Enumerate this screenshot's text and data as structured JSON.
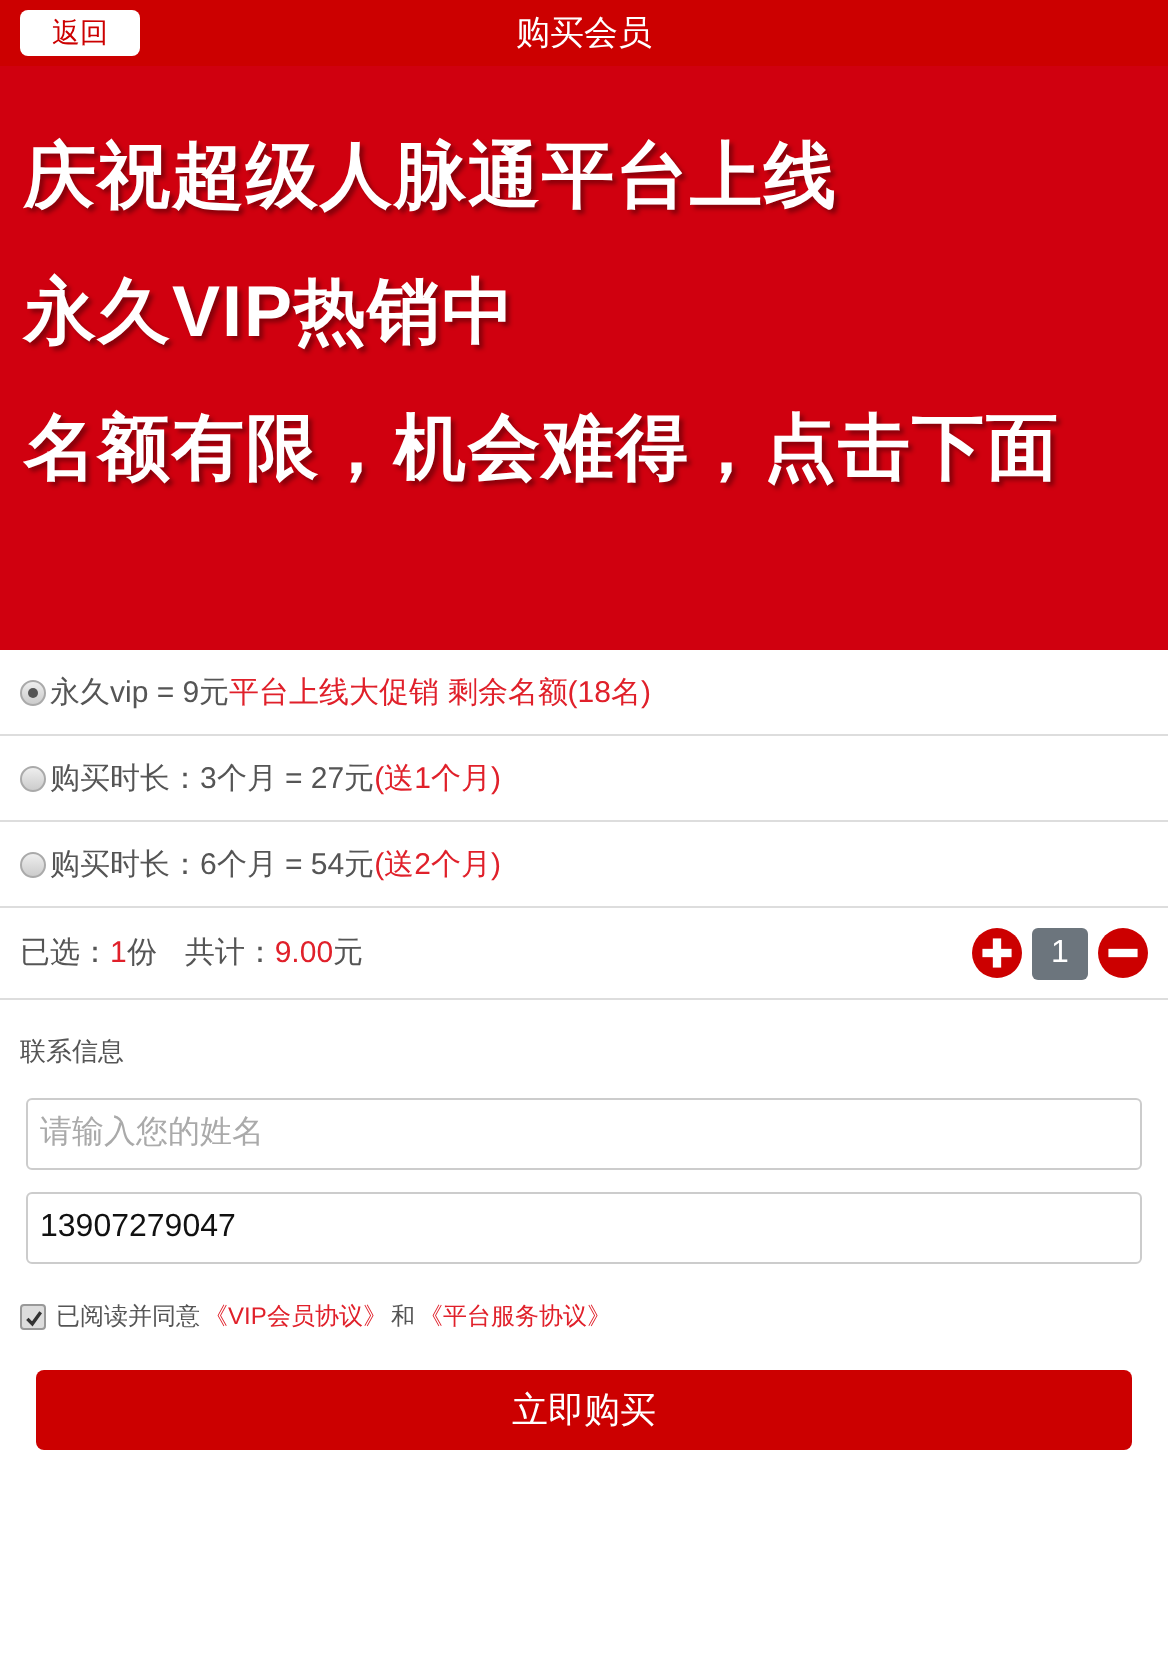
{
  "header": {
    "back_button": "返回",
    "title": "购买会员"
  },
  "banner": {
    "lines": [
      "庆祝超级人脉通平台上线",
      "永久VIP热销中",
      "名额有限，机会难得，点击下面"
    ]
  },
  "plans": [
    {
      "label": "永久vip = 9元 ",
      "promo": "平台上线大促销 剩余名额(18名)",
      "selected": true
    },
    {
      "label": "购买时长：3个月 = 27元",
      "promo": "(送1个月)",
      "selected": false
    },
    {
      "label": "购买时长：6个月 = 54元",
      "promo": "(送2个月)",
      "selected": false
    }
  ],
  "summary": {
    "selected_label": "已选：",
    "count": "1",
    "count_unit": "份",
    "total_label": "共计：",
    "total": "9.00",
    "total_unit": "元",
    "quantity": "1"
  },
  "contact": {
    "heading": "联系信息",
    "name_placeholder": "请输入您的姓名",
    "phone_value": "13907279047"
  },
  "agreement": {
    "checked": true,
    "text": "已阅读并同意",
    "link_1": "《VIP会员协议》",
    "joiner": "和",
    "link_2": "《平台服务协议》"
  },
  "submit_button": "立即购买"
}
